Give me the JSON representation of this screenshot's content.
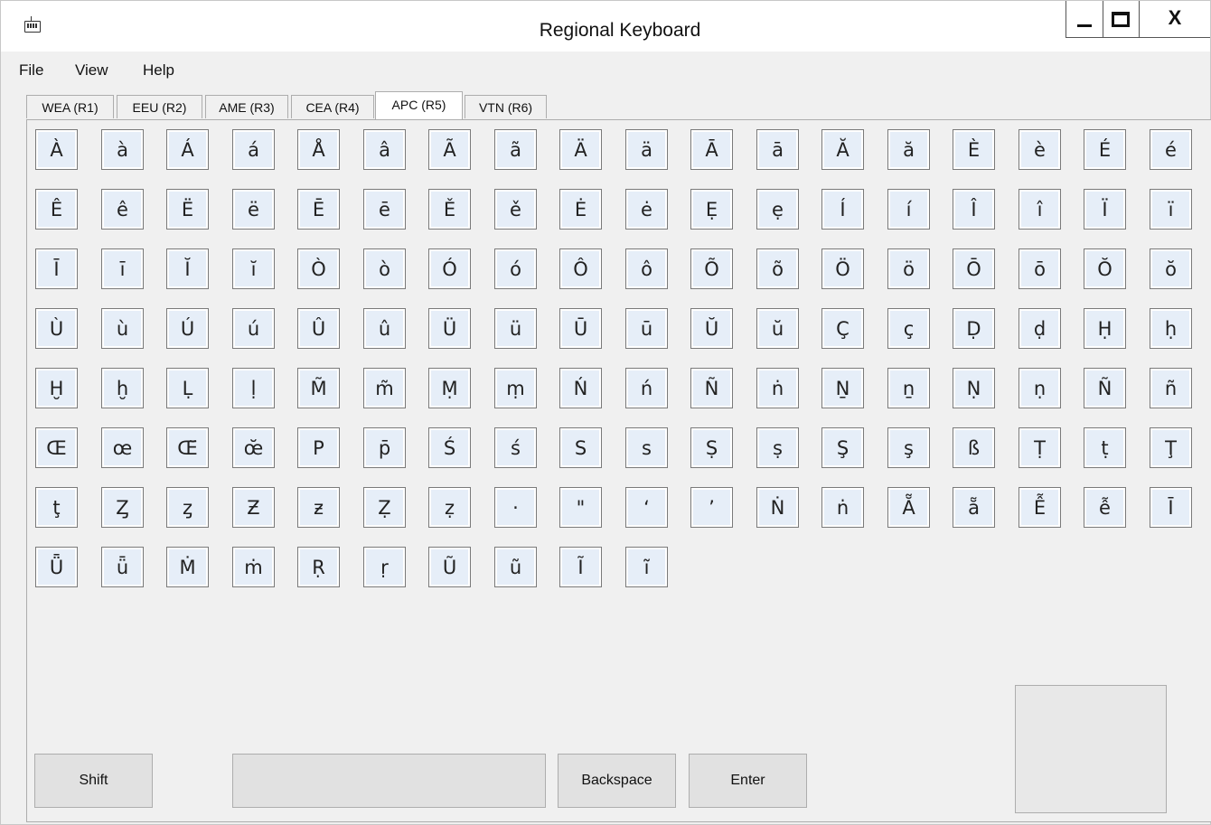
{
  "window": {
    "title": "Regional Keyboard",
    "icon": "keyboard-icon",
    "controls": {
      "minimize": "_",
      "maximize": "□",
      "close": "X"
    }
  },
  "menu": [
    "File",
    "View",
    "Help"
  ],
  "tabs": [
    {
      "label": "WEA (R1)",
      "active": false
    },
    {
      "label": "EEU (R2)",
      "active": false
    },
    {
      "label": "AME (R3)",
      "active": false
    },
    {
      "label": "CEA (R4)",
      "active": false
    },
    {
      "label": "APC (R5)",
      "active": true
    },
    {
      "label": "VTN (R6)",
      "active": false
    }
  ],
  "keys": [
    [
      "À",
      "à",
      "Á",
      "á",
      "Å",
      "â",
      "Ã",
      "ã",
      "Ä",
      "ä",
      "Ā",
      "ā",
      "Ă",
      "ă",
      "È",
      "è",
      "É",
      "é"
    ],
    [
      "Ê",
      "ê",
      "Ë",
      "ë",
      "Ē",
      "ē",
      "Ě",
      "ě",
      "Ė",
      "ė",
      "Ẹ",
      "ẹ",
      "Í",
      "í",
      "Î",
      "î",
      "Ï",
      "ï"
    ],
    [
      "Ī",
      "ī",
      "Ĭ",
      "ĭ",
      "Ò",
      "ò",
      "Ó",
      "ó",
      "Ô",
      "ô",
      "Õ",
      "õ",
      "Ö",
      "ö",
      "Ō",
      "ō",
      "Ŏ",
      "ŏ"
    ],
    [
      "Ù",
      "ù",
      "Ú",
      "ú",
      "Û",
      "û",
      "Ü",
      "ü",
      "Ū",
      "ū",
      "Ŭ",
      "ŭ",
      "Ç",
      "ç",
      "Ḍ",
      "ḍ",
      "Ḥ",
      "ḥ"
    ],
    [
      "Ḫ",
      "ḫ",
      "Ḷ",
      "ḷ",
      "M̃",
      "m̃",
      "Ṃ",
      "ṃ",
      "Ń",
      "ń",
      "Ñ",
      "ṅ",
      "Ṉ",
      "ṉ",
      "Ṇ",
      "ṇ",
      "Ñ",
      "ñ"
    ],
    [
      "Œ",
      "œ",
      "Œ̆",
      "œ̆",
      "P",
      "p̄",
      "Ś",
      "ś",
      "S",
      "s",
      "Ṣ",
      "ṣ",
      "Ş",
      "ş",
      "ß",
      "Ṭ",
      "ṭ",
      "Ţ"
    ],
    [
      "ţ",
      "Ȥ",
      "ȥ",
      "Ƶ",
      "ƶ",
      "Ẓ",
      "ẓ",
      "·",
      "\"",
      "‘",
      "’",
      "Ṅ",
      "ṅ",
      "Ẵ",
      "ẵ",
      "Ễ",
      "ễ",
      "Ī"
    ],
    [
      "Ǖ",
      "ǖ",
      "Ṁ",
      "ṁ",
      "Ṛ",
      "ṛ",
      "Ũ",
      "ũ",
      "Ĩ",
      "ĩ"
    ]
  ],
  "buttons": {
    "shift": "Shift",
    "space": "",
    "backspace": "Backspace",
    "enter": "Enter"
  }
}
